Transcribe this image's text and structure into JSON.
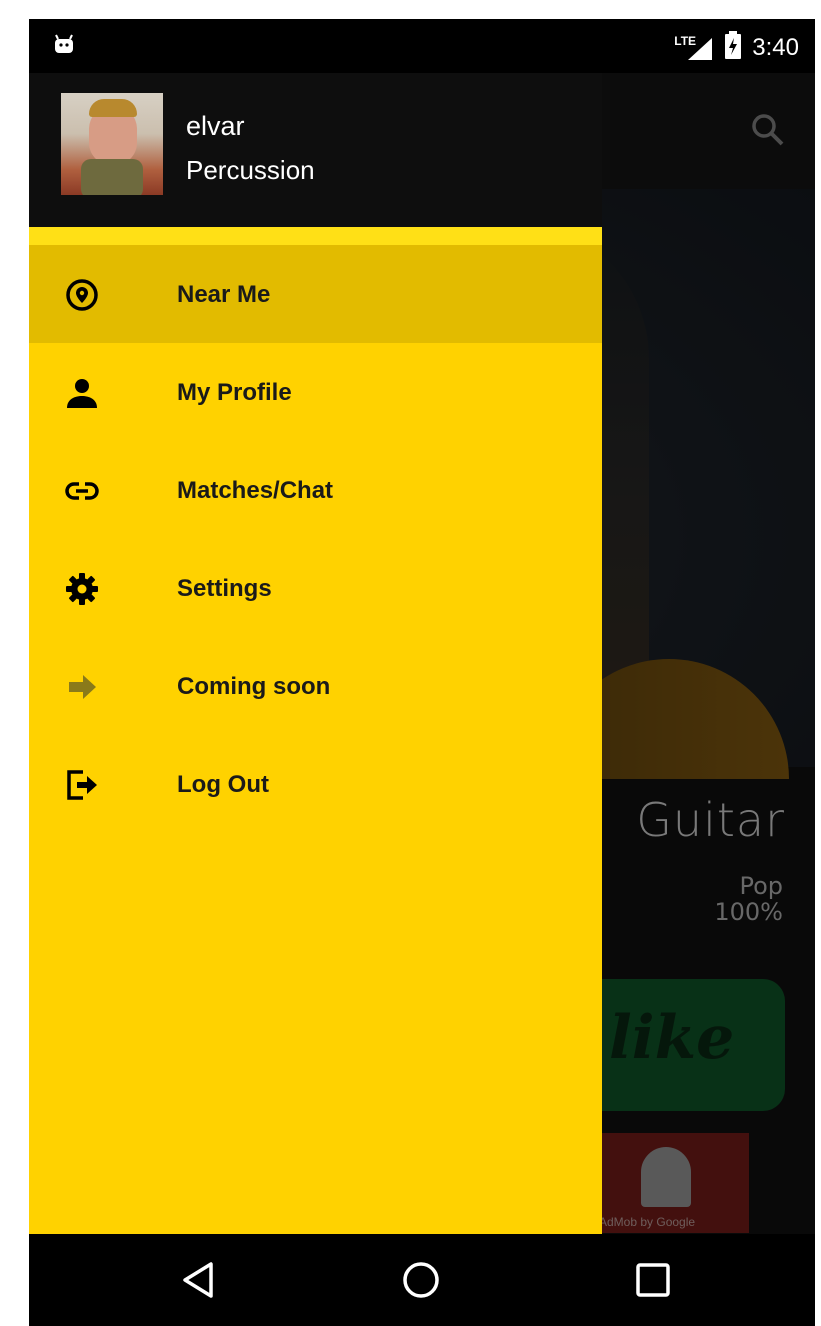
{
  "status_bar": {
    "network": "LTE",
    "time": "3:40"
  },
  "background": {
    "instrument": "Guitar",
    "genre": "Pop",
    "match": "100%",
    "like_label": "like",
    "ad_label": "AdMob by Google"
  },
  "drawer": {
    "user": {
      "name": "elvar",
      "role": "Percussion"
    },
    "items": [
      {
        "label": "Near Me",
        "icon": "location-pin-icon",
        "active": true
      },
      {
        "label": "My Profile",
        "icon": "person-icon",
        "active": false
      },
      {
        "label": "Matches/Chat",
        "icon": "link-icon",
        "active": false
      },
      {
        "label": "Settings",
        "icon": "gear-icon",
        "active": false
      },
      {
        "label": "Coming soon",
        "icon": "arrow-right-icon",
        "active": false
      },
      {
        "label": "Log Out",
        "icon": "logout-icon",
        "active": false
      }
    ]
  },
  "colors": {
    "drawer": "#ffd200",
    "drawer_active": "#e2bb00",
    "header": "#0e0e0e"
  },
  "nav_bar": {
    "buttons": [
      "back-icon",
      "home-icon",
      "recents-icon"
    ]
  }
}
